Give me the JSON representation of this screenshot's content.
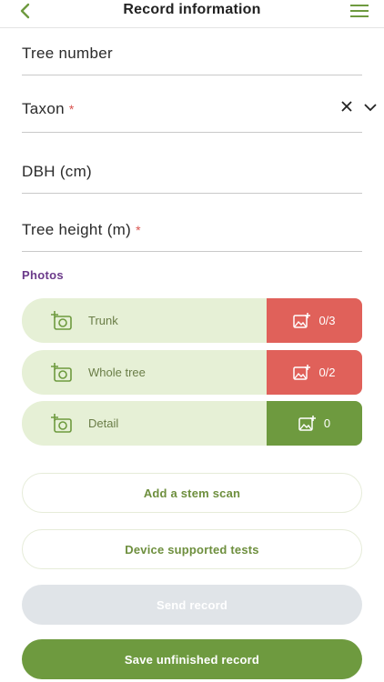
{
  "header": {
    "title": "Record information",
    "back_icon": "chevron-left-icon",
    "menu_icon": "hamburger-menu-icon"
  },
  "fields": {
    "tree_number": {
      "label": "Tree number"
    },
    "taxon": {
      "label": "Taxon",
      "required_mark": "*"
    },
    "dbh": {
      "label": "DBH (cm)"
    },
    "tree_height": {
      "label": "Tree height (m)",
      "required_mark": "*"
    }
  },
  "photos": {
    "section_label": "Photos",
    "items": [
      {
        "label": "Trunk",
        "count": "0/3",
        "status_color": "#e0615a"
      },
      {
        "label": "Whole tree",
        "count": "0/2",
        "status_color": "#e0615a"
      },
      {
        "label": "Detail",
        "count": "0",
        "status_color": "#6e9a3f"
      }
    ]
  },
  "actions": {
    "add_stem_scan": "Add a stem scan",
    "device_tests": "Device supported tests",
    "send_record": "Send record",
    "save_unfinished": "Save unfinished record"
  },
  "colors": {
    "accent_green": "#6e9a3f",
    "light_green": "#e6f0d6",
    "alert_red": "#e0615a",
    "section_purple": "#6b3a8a"
  }
}
